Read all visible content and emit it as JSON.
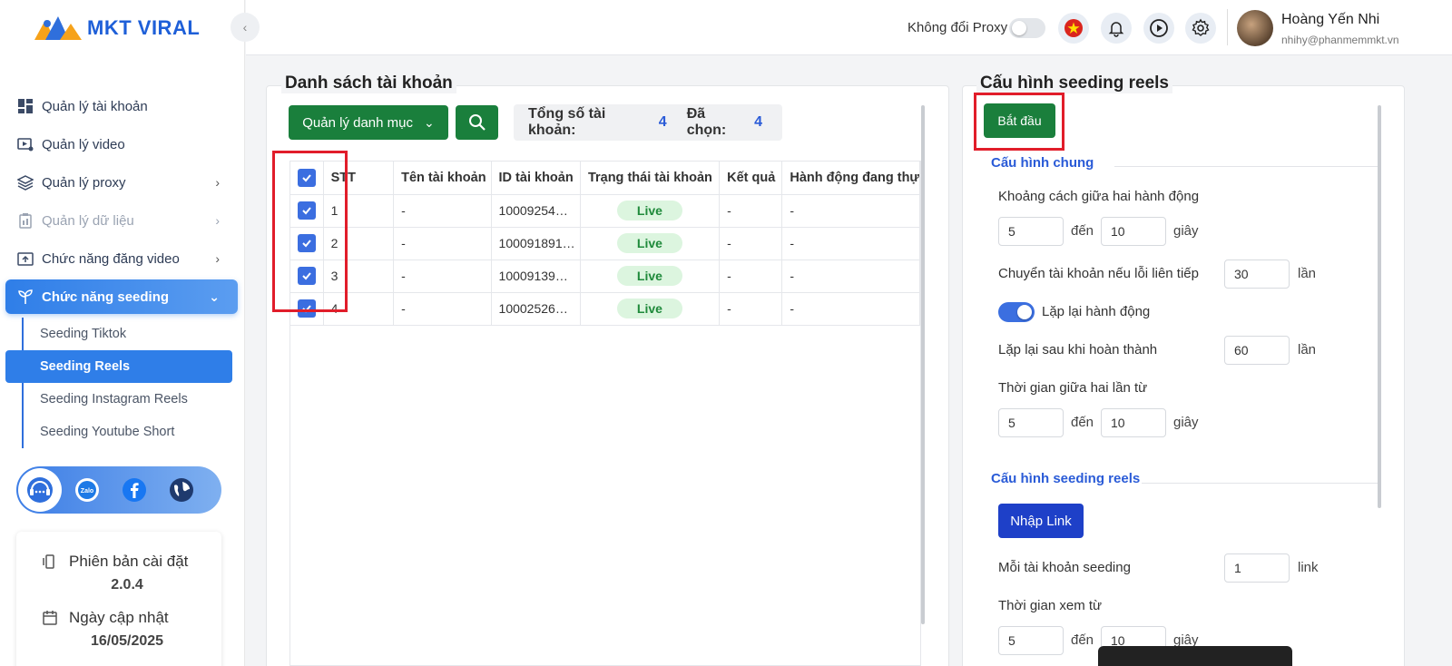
{
  "app": {
    "brand": "MKT VIRAL"
  },
  "sidebar": {
    "items": [
      {
        "label": "Quản lý tài khoản",
        "icon": "dashboard-icon"
      },
      {
        "label": "Quản lý video",
        "icon": "video-icon"
      },
      {
        "label": "Quản lý proxy",
        "icon": "layers-icon"
      },
      {
        "label": "Quản lý dữ liệu",
        "icon": "clipboard-icon"
      },
      {
        "label": "Chức năng đăng video",
        "icon": "upload-icon"
      },
      {
        "label": "Chức năng seeding",
        "icon": "seedling-icon"
      }
    ],
    "sub_items": [
      {
        "label": "Seeding Tiktok"
      },
      {
        "label": "Seeding Reels"
      },
      {
        "label": "Seeding Instagram Reels"
      },
      {
        "label": "Seeding Youtube Short"
      }
    ],
    "version_label": "Phiên bản cài đặt",
    "version_value": "2.0.4",
    "update_label": "Ngày cập nhật",
    "update_value": "16/05/2025"
  },
  "topbar": {
    "proxy_label": "Không đổi Proxy",
    "user_name": "Hoàng Yến Nhi",
    "user_email": "nhihy@phanmemmkt.vn"
  },
  "accounts": {
    "title": "Danh sách tài khoản",
    "category_button": "Quản lý danh mục",
    "total_label": "Tổng số tài khoản:",
    "total_value": "4",
    "selected_label": "Đã chọn:",
    "selected_value": "4",
    "columns": [
      "STT",
      "Tên tài khoản",
      "ID tài khoản",
      "Trạng thái tài khoản",
      "Kết quả",
      "Hành động đang thự"
    ],
    "rows": [
      {
        "stt": "1",
        "name": "-",
        "id": "10009254…",
        "status": "Live",
        "result": "-",
        "action": "-"
      },
      {
        "stt": "2",
        "name": "-",
        "id": "100091891…",
        "status": "Live",
        "result": "-",
        "action": "-"
      },
      {
        "stt": "3",
        "name": "-",
        "id": "10009139…",
        "status": "Live",
        "result": "-",
        "action": "-"
      },
      {
        "stt": "4",
        "name": "-",
        "id": "10002526…",
        "status": "Live",
        "result": "-",
        "action": "-"
      }
    ]
  },
  "config": {
    "title": "Cấu hình seeding reels",
    "start_button": "Bắt đầu",
    "general_title": "Cấu hình chung",
    "interval_label": "Khoảng cách giữa hai hành động",
    "interval_from": "5",
    "interval_to": "10",
    "to_word": "đến",
    "seconds_word": "giây",
    "times_word": "lần",
    "switch_label": "Chuyển tài khoản nếu lỗi liên tiếp",
    "switch_value": "30",
    "repeat_toggle_label": "Lặp lại hành động",
    "repeat_after_label": "Lặp lại sau khi hoàn thành",
    "repeat_after_value": "60",
    "between_label": "Thời gian giữa hai lần từ",
    "between_from": "5",
    "between_to": "10",
    "reels_title": "Cấu hình seeding reels",
    "import_button": "Nhập Link",
    "per_account_label": "Mỗi tài khoản seeding",
    "per_account_value": "1",
    "link_word": "link",
    "watch_label": "Thời gian xem từ",
    "watch_from": "5",
    "watch_to": "10"
  },
  "colors": {
    "accent": "#2f7ee8",
    "green": "#1a7f3c",
    "live_bg": "#dcf5df",
    "highlight": "#e11d2a"
  }
}
